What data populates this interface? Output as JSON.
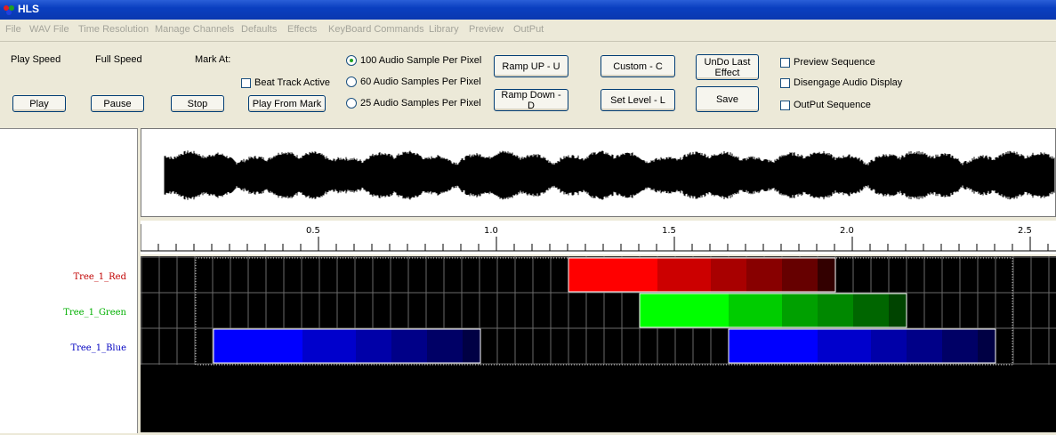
{
  "window": {
    "title": "HLS"
  },
  "menu": [
    "File",
    "WAV File",
    "Time Resolution",
    "Manage Channels",
    "Defaults",
    "Effects",
    "KeyBoard Commands",
    "Library",
    "Preview",
    "OutPut"
  ],
  "labels": {
    "play_speed": "Play Speed",
    "full_speed": "Full Speed",
    "mark_at": "Mark At:"
  },
  "buttons": {
    "play": "Play",
    "pause": "Pause",
    "stop": "Stop",
    "play_from_mark": "Play From Mark",
    "ramp_up": "Ramp UP - U",
    "ramp_down": "Ramp Down - D",
    "custom": "Custom - C",
    "set_level": "Set Level - L",
    "undo": "UnDo Last Effect",
    "save": "Save"
  },
  "checkboxes": {
    "beat_track": {
      "label": "Beat Track Active",
      "checked": false
    },
    "preview_sequence": {
      "label": "Preview Sequence",
      "checked": false
    },
    "disengage_audio": {
      "label": "Disengage Audio Display",
      "checked": false
    },
    "output_sequence": {
      "label": "OutPut Sequence",
      "checked": false
    }
  },
  "resolution": {
    "options": [
      "100 Audio Sample Per Pixel",
      "60 Audio Samples Per Pixel",
      "25 Audio Samples Per Pixel"
    ],
    "selected": 0
  },
  "timeline": {
    "ticks": [
      "0.5",
      "1.0",
      "1.5",
      "2.0",
      "2.5"
    ]
  },
  "channels": [
    {
      "name": "Tree_1_Red",
      "color": "#ff0000"
    },
    {
      "name": "Tree_1_Green",
      "color": "#00ff00"
    },
    {
      "name": "Tree_1_Blue",
      "color": "#0000ff"
    }
  ]
}
